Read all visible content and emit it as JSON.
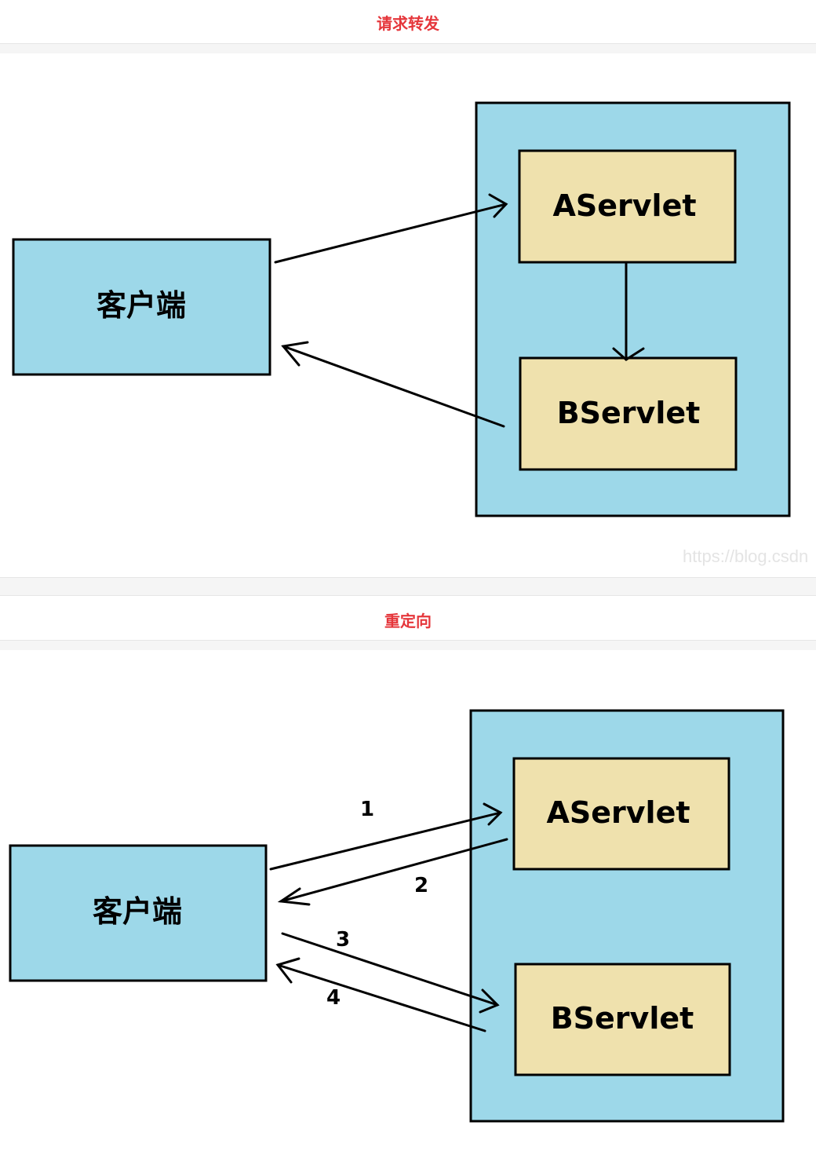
{
  "sections": [
    {
      "title": "请求转发",
      "client_label": "客户端",
      "servlet_a_label": "AServlet",
      "servlet_b_label": "BServlet",
      "watermark": "https://blog.csdn"
    },
    {
      "title": "重定向",
      "client_label": "客户端",
      "servlet_a_label": "AServlet",
      "servlet_b_label": "BServlet",
      "step_labels": [
        "1",
        "2",
        "3",
        "4"
      ]
    }
  ],
  "colors": {
    "title": "#e5363b",
    "container_fill": "#9dd8e9",
    "servlet_fill": "#efe1ad",
    "client_fill": "#9dd8e9",
    "stroke": "#000000"
  }
}
